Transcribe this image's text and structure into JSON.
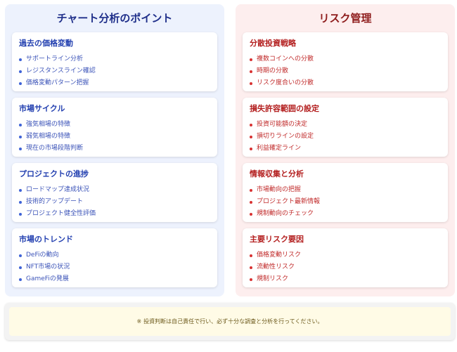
{
  "left": {
    "title": "チャート分析のポイント",
    "cards": [
      {
        "title": "過去の価格変動",
        "items": [
          "サポートライン分析",
          "レジスタンスライン確認",
          "価格変動パターン把握"
        ]
      },
      {
        "title": "市場サイクル",
        "items": [
          "強気相場の特徴",
          "弱気相場の特徴",
          "現在の市場段階判断"
        ]
      },
      {
        "title": "プロジェクトの進捗",
        "items": [
          "ロードマップ達成状況",
          "技術的アップデート",
          "プロジェクト健全性評価"
        ]
      },
      {
        "title": "市場のトレンド",
        "items": [
          "DeFiの動向",
          "NFT市場の状況",
          "GameFiの発展"
        ]
      }
    ]
  },
  "right": {
    "title": "リスク管理",
    "cards": [
      {
        "title": "分散投資戦略",
        "items": [
          "複数コインへの分散",
          "時期の分散",
          "リスク度合いの分散"
        ]
      },
      {
        "title": "損失許容範囲の設定",
        "items": [
          "投資可能額の決定",
          "損切りラインの設定",
          "利益確定ライン"
        ]
      },
      {
        "title": "情報収集と分析",
        "items": [
          "市場動向の把握",
          "プロジェクト最新情報",
          "規制動向のチェック"
        ]
      },
      {
        "title": "主要リスク要因",
        "items": [
          "価格変動リスク",
          "流動性リスク",
          "規制リスク"
        ]
      }
    ]
  },
  "notice": {
    "icon": "※",
    "text": "投資判断は自己責任で行い、必ず十分な調査と分析を行ってください。"
  },
  "colors": {
    "left_bg": "#edf2fd",
    "right_bg": "#fdeeee",
    "left_accent": "#2340b0",
    "right_accent": "#b31e1e",
    "notice_bg": "#fffbe6"
  }
}
